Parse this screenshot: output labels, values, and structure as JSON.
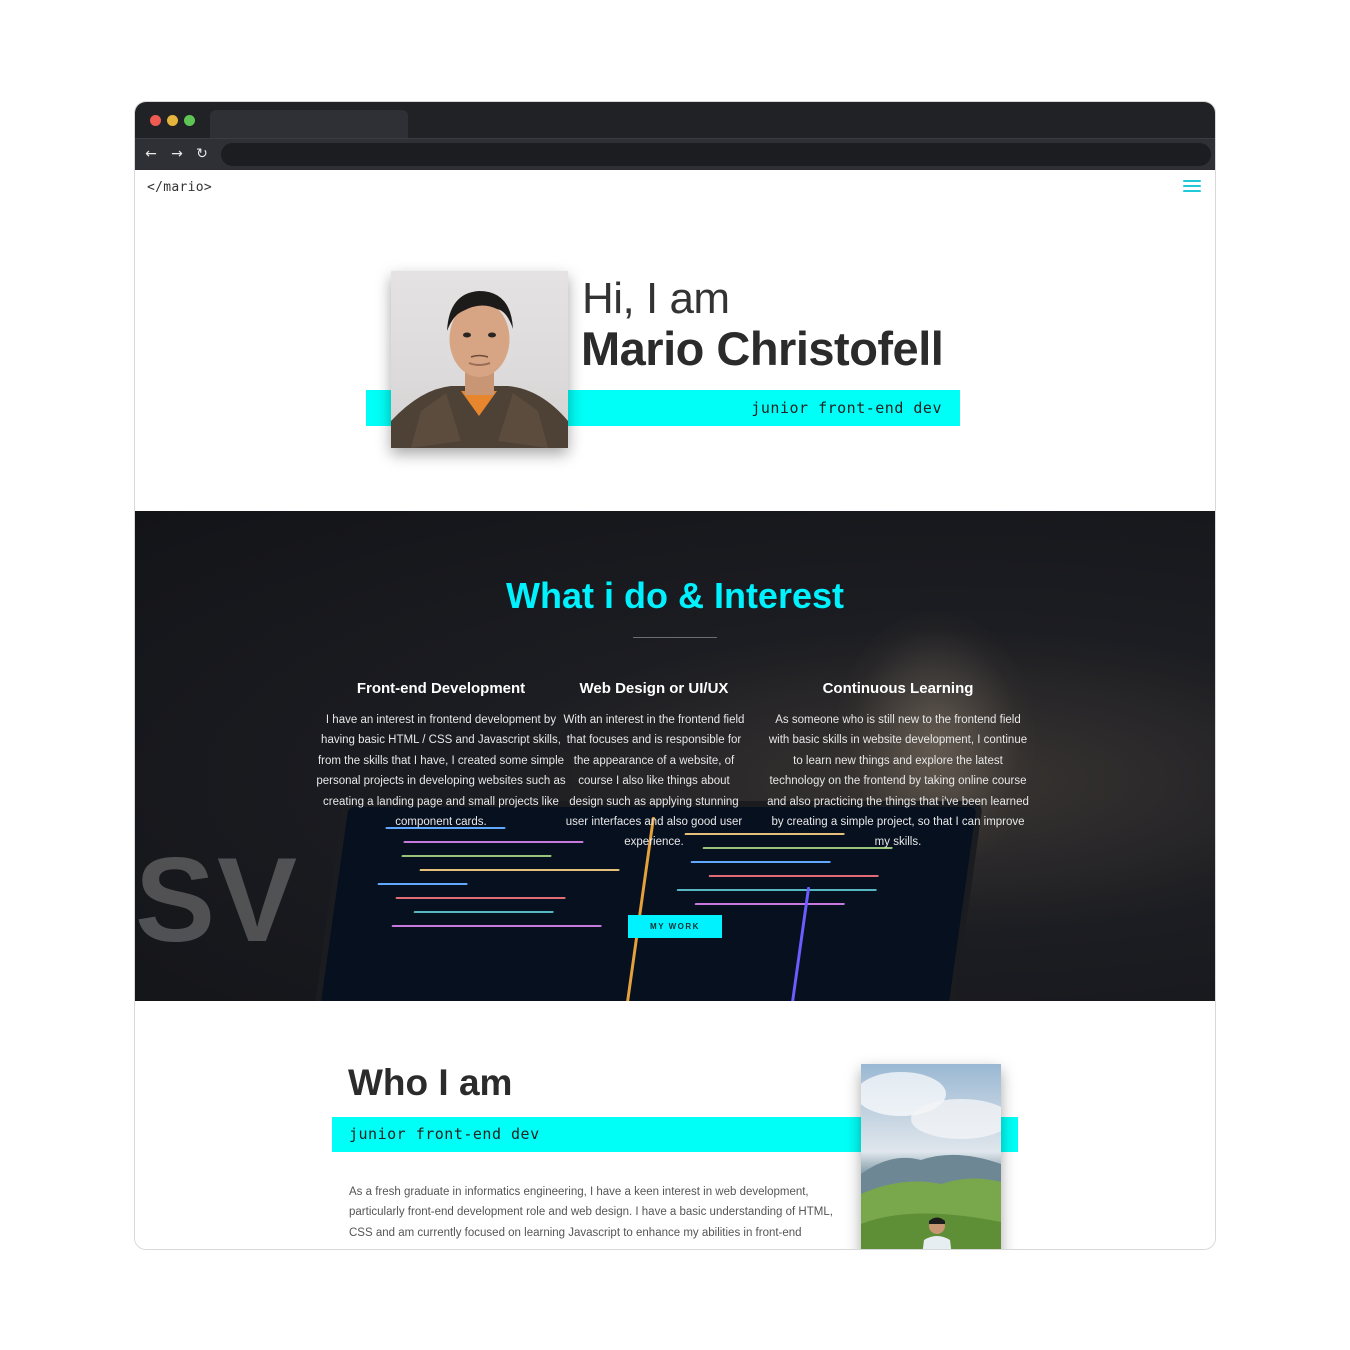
{
  "browser": {
    "tab_title": "",
    "url": "",
    "icons": [
      "back-arrow-icon",
      "forward-arrow-icon",
      "reload-icon"
    ]
  },
  "nav": {
    "logo": "</mario>",
    "menu_icon": "hamburger-menu-icon"
  },
  "hero": {
    "greeting": "Hi, I am",
    "name": "Mario Christofell",
    "role": "junior front-end dev"
  },
  "interest": {
    "title": "What i do & Interest",
    "columns": [
      {
        "title": "Front-end Development",
        "body": "I have an interest in frontend development by having basic HTML / CSS and Javascript skills, from the skills that I have, I created some simple personal projects in developing websites such as creating a landing page and small projects like component cards."
      },
      {
        "title": "Web Design or UI/UX",
        "body": "With an interest in the frontend field that focuses and is responsible for the appearance of a website, of course I also like things about design such as applying stunning user interfaces and also good user experience."
      },
      {
        "title": "Continuous Learning",
        "body": "As someone who is still new to the frontend field with basic skills in website development, I continue to learn new things and explore the latest technology on the frontend by taking online course and also practicing the things that i've been learned by creating a simple project, so that I can improve my skills."
      }
    ],
    "button_label": "MY WORK"
  },
  "about": {
    "title": "Who I am",
    "role": "junior front-end dev",
    "body": "As a fresh graduate in informatics engineering, I have a keen interest in web development, particularly front-end development role and web design. I have a basic understanding of HTML, CSS and am currently focused on learning Javascript to enhance my abilities in front-end"
  },
  "colors": {
    "accent": "#00fff7",
    "heading_accent": "#00f2ff",
    "dark_bg": "#16171b",
    "chrome_bg": "#212226"
  }
}
